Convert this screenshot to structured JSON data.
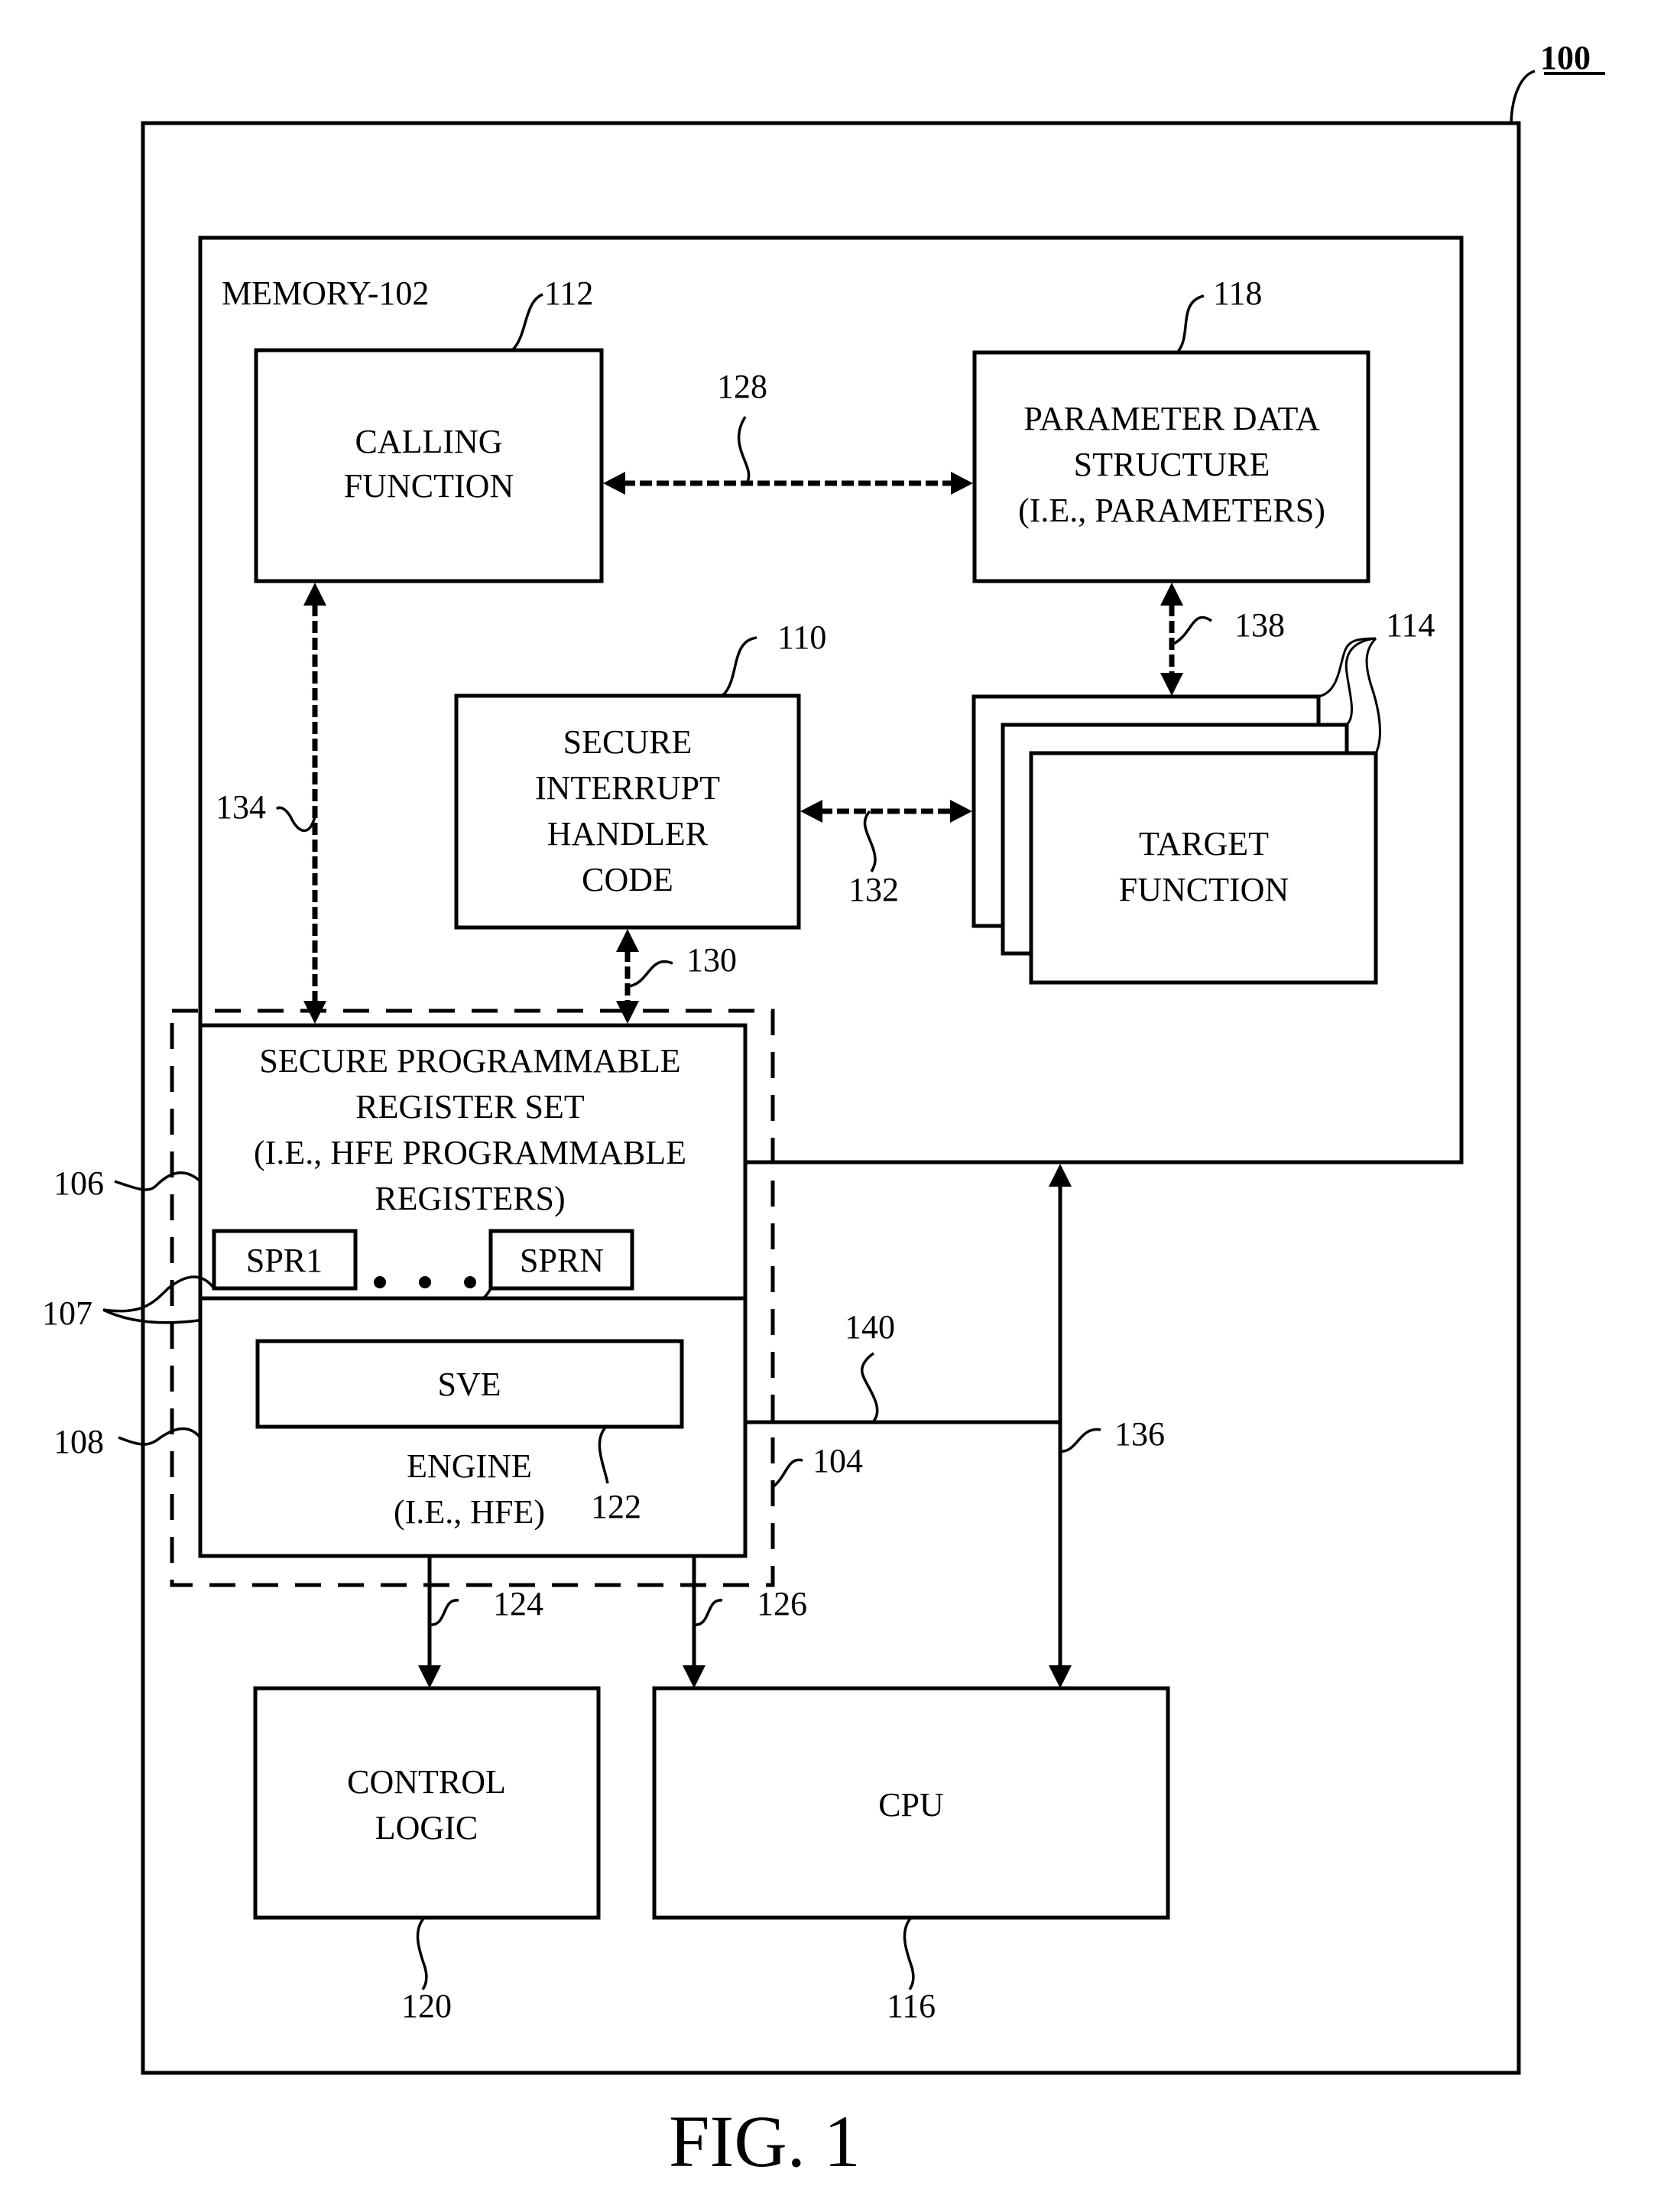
{
  "figure": {
    "caption": "FIG. 1",
    "system_ref": "100",
    "colors": {
      "line": "#000000",
      "background": "#ffffff"
    }
  },
  "memory": {
    "label": "MEMORY-102"
  },
  "blocks": {
    "calling_function": {
      "lines": [
        "CALLING",
        "FUNCTION"
      ],
      "ref": "112"
    },
    "parameter_data_structure": {
      "lines": [
        "PARAMETER DATA",
        "STRUCTURE",
        "(I.E., PARAMETERS)"
      ],
      "ref": "118"
    },
    "secure_interrupt_handler": {
      "lines": [
        "SECURE",
        "INTERRUPT",
        "HANDLER",
        "CODE"
      ],
      "ref": "110"
    },
    "target_function": {
      "lines": [
        "TARGET",
        "FUNCTION"
      ],
      "ref": "114"
    },
    "register_set": {
      "lines": [
        "SECURE PROGRAMMABLE",
        "REGISTER SET",
        "(I.E., HFE PROGRAMMABLE",
        "REGISTERS)"
      ],
      "ref": "106"
    },
    "spr1": {
      "label": "SPR1"
    },
    "sprn": {
      "label": "SPRN"
    },
    "registers_ref": "107",
    "engine": {
      "lines": [
        "ENGINE",
        "(I.E., HFE)"
      ],
      "ref": "108"
    },
    "sve": {
      "label": "SVE",
      "ref": "122"
    },
    "hfe_group_ref": "104",
    "control_logic": {
      "lines": [
        "CONTROL",
        "LOGIC"
      ],
      "ref": "120"
    },
    "cpu": {
      "label": "CPU",
      "ref": "116"
    }
  },
  "connections": {
    "c128": "128",
    "c130": "130",
    "c132": "132",
    "c134": "134",
    "c136": "136",
    "c138": "138",
    "c140": "140",
    "c124": "124",
    "c126": "126"
  }
}
